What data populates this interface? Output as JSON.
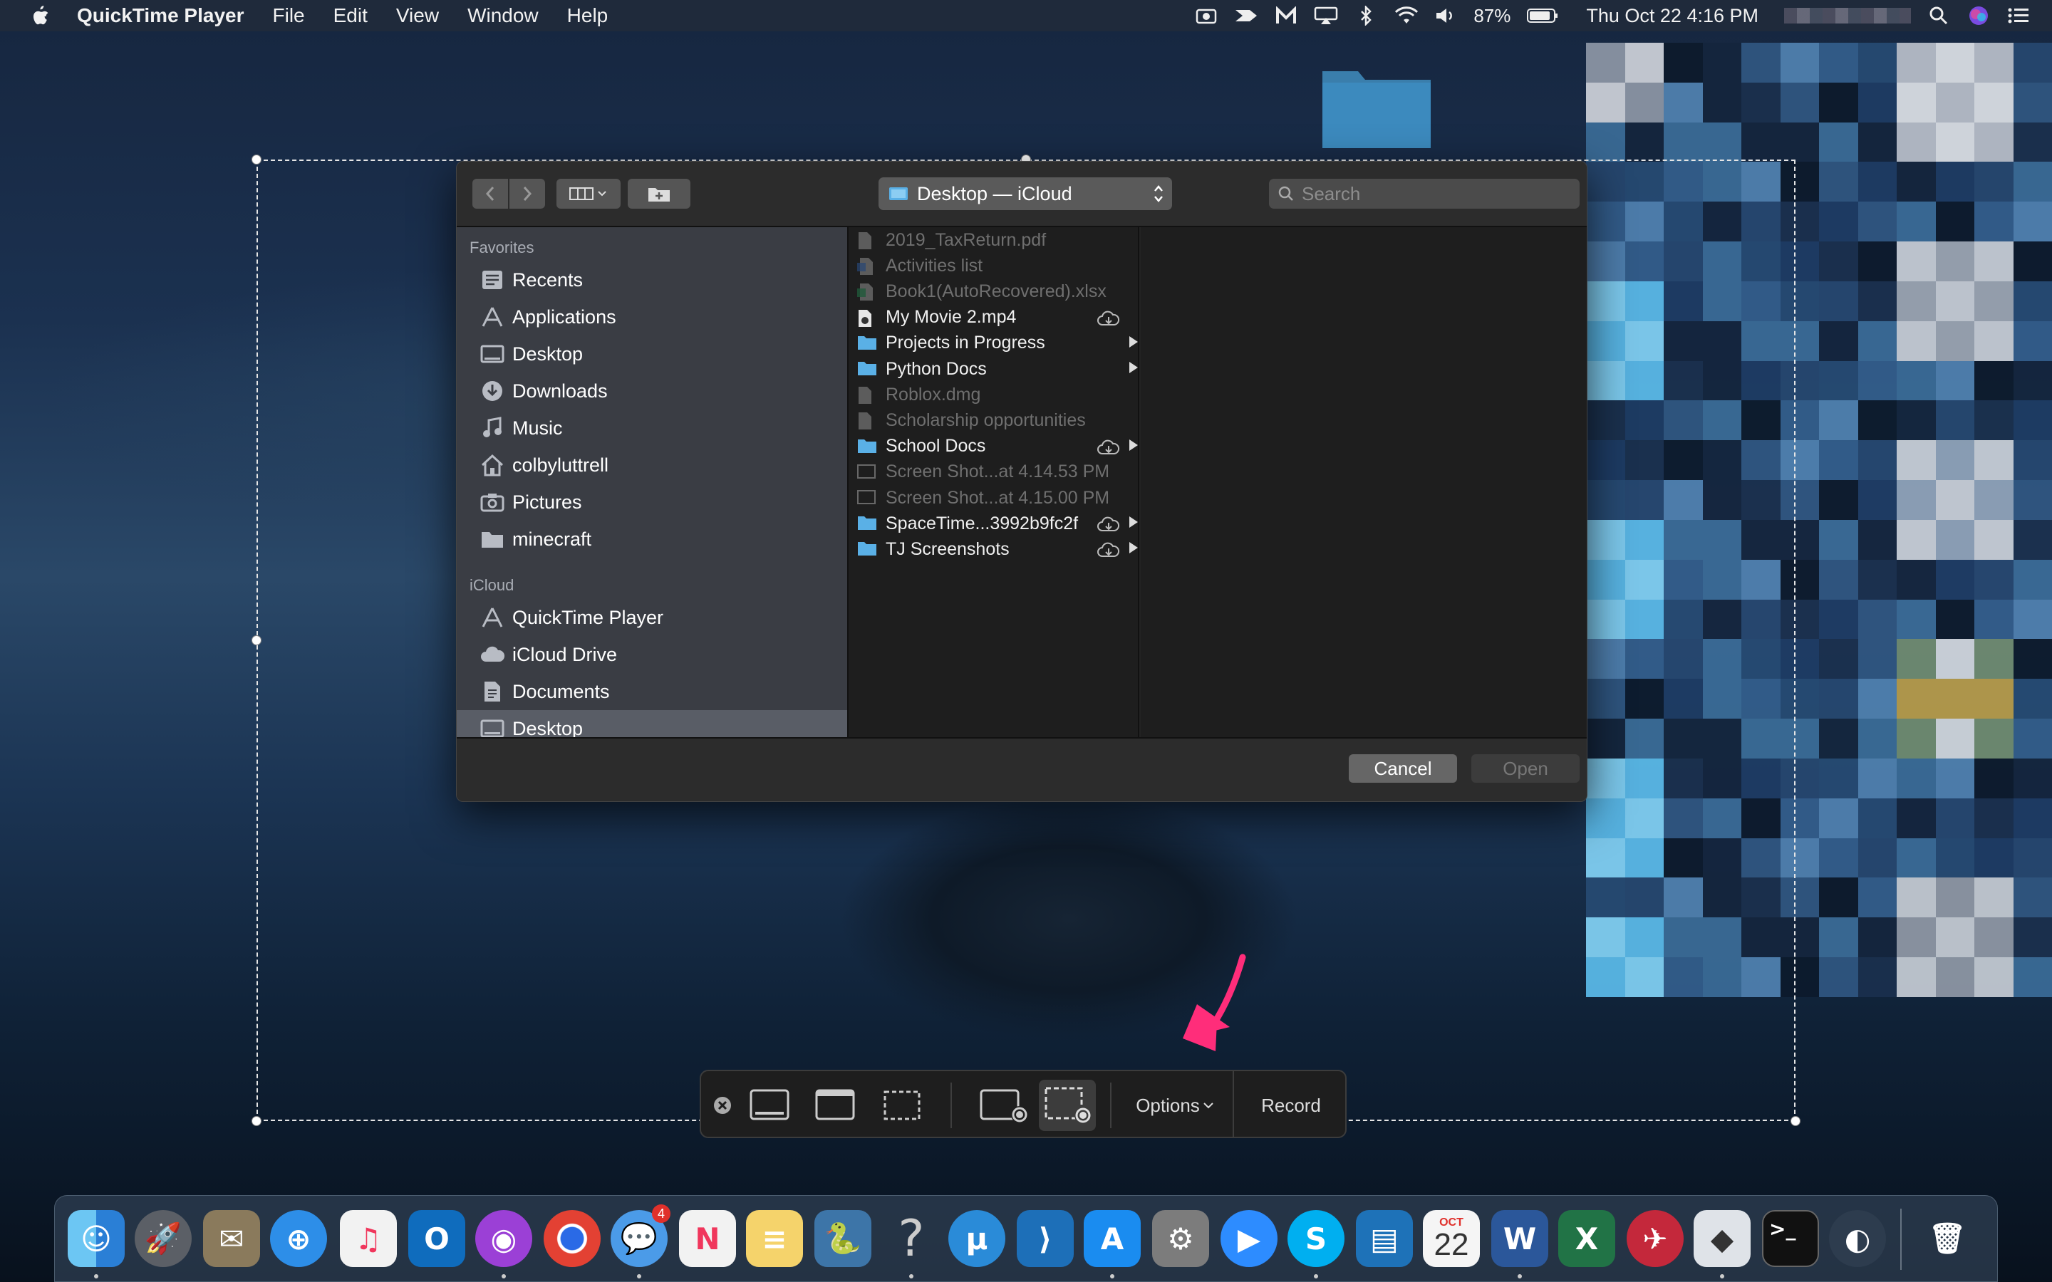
{
  "menubar": {
    "app": "QuickTime Player",
    "items": [
      "File",
      "Edit",
      "View",
      "Window",
      "Help"
    ],
    "battery": "87%",
    "clock": "Thu Oct 22  4:16 PM"
  },
  "dialog": {
    "location": "Desktop — iCloud",
    "search_placeholder": "Search",
    "sidebar": {
      "favorites_header": "Favorites",
      "favorites": [
        {
          "label": "Recents",
          "icon": "recents-icon"
        },
        {
          "label": "Applications",
          "icon": "applications-icon"
        },
        {
          "label": "Desktop",
          "icon": "desktop-icon"
        },
        {
          "label": "Downloads",
          "icon": "downloads-icon"
        },
        {
          "label": "Music",
          "icon": "music-icon"
        },
        {
          "label": "colbyluttrell",
          "icon": "home-icon"
        },
        {
          "label": "Pictures",
          "icon": "pictures-icon"
        },
        {
          "label": "minecraft",
          "icon": "folder-icon"
        }
      ],
      "icloud_header": "iCloud",
      "icloud": [
        {
          "label": "QuickTime Player",
          "icon": "applications-icon"
        },
        {
          "label": "iCloud Drive",
          "icon": "cloud-icon"
        },
        {
          "label": "Documents",
          "icon": "document-icon"
        },
        {
          "label": "Desktop",
          "icon": "desktop-icon",
          "selected": true
        }
      ]
    },
    "files": [
      {
        "name": "2019_TaxReturn.pdf",
        "type": "doc",
        "enabled": false
      },
      {
        "name": "Activities list",
        "type": "word",
        "enabled": false
      },
      {
        "name": "Book1(AutoRecovered).xlsx",
        "type": "excel",
        "enabled": false
      },
      {
        "name": "My Movie 2.mp4",
        "type": "movie",
        "enabled": true,
        "cloud": true
      },
      {
        "name": "Projects in Progress",
        "type": "folder",
        "enabled": true,
        "arrow": true
      },
      {
        "name": "Python Docs",
        "type": "folder",
        "enabled": true,
        "arrow": true
      },
      {
        "name": "Roblox.dmg",
        "type": "doc",
        "enabled": false
      },
      {
        "name": "Scholarship opportunities",
        "type": "doc",
        "enabled": false
      },
      {
        "name": "School Docs",
        "type": "folder",
        "enabled": true,
        "cloud": true,
        "arrow": true
      },
      {
        "name": "Screen Shot...at 4.14.53 PM",
        "type": "image",
        "enabled": false
      },
      {
        "name": "Screen Shot...at 4.15.00 PM",
        "type": "image",
        "enabled": false
      },
      {
        "name": "SpaceTime...3992b9fc2f",
        "type": "folder",
        "enabled": true,
        "cloud": true,
        "arrow": true
      },
      {
        "name": "TJ Screenshots",
        "type": "folder",
        "enabled": true,
        "cloud": true,
        "arrow": true
      }
    ],
    "cancel": "Cancel",
    "open": "Open"
  },
  "capture_bar": {
    "options": "Options",
    "record": "Record"
  },
  "dock": {
    "calendar_month": "OCT",
    "calendar_day": "22",
    "messages_badge": "4"
  },
  "colors": {
    "accent": "#ff2d7a",
    "folder": "#5ab0e6",
    "selection": "#e6e6e6"
  }
}
